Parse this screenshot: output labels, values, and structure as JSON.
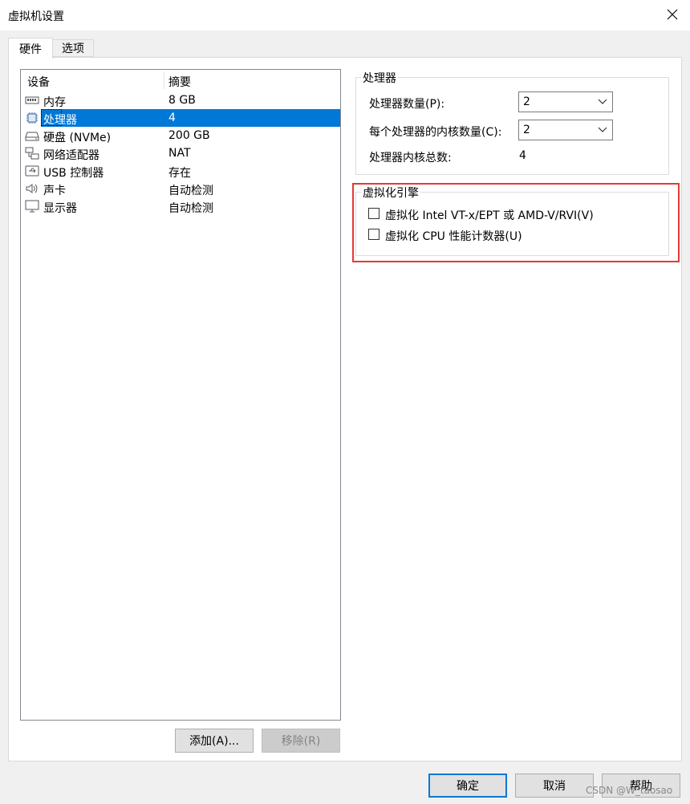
{
  "window": {
    "title": "虚拟机设置"
  },
  "tabs": [
    {
      "label": "硬件",
      "active": true
    },
    {
      "label": "选项",
      "active": false
    }
  ],
  "device_list": {
    "columns": [
      "设备",
      "摘要"
    ],
    "rows": [
      {
        "name": "内存",
        "summary": "8 GB",
        "icon": "memory-icon"
      },
      {
        "name": "处理器",
        "summary": "4",
        "icon": "processor-icon",
        "selected": true
      },
      {
        "name": "硬盘 (NVMe)",
        "summary": "200 GB",
        "icon": "hard-disk-icon"
      },
      {
        "name": "网络适配器",
        "summary": "NAT",
        "icon": "network-adapter-icon"
      },
      {
        "name": "USB 控制器",
        "summary": "存在",
        "icon": "usb-controller-icon"
      },
      {
        "name": "声卡",
        "summary": "自动检测",
        "icon": "sound-card-icon"
      },
      {
        "name": "显示器",
        "summary": "自动检测",
        "icon": "display-icon"
      }
    ]
  },
  "device_buttons": {
    "add": "添加(A)...",
    "remove": "移除(R)"
  },
  "processor_group": {
    "title": "处理器",
    "count_label": "处理器数量(P):",
    "count_value": "2",
    "cores_label": "每个处理器的内核数量(C):",
    "cores_value": "2",
    "total_label": "处理器内核总数:",
    "total_value": "4"
  },
  "virtualization_group": {
    "title": "虚拟化引擎",
    "option1": "虚拟化 Intel VT-x/EPT 或 AMD-V/RVI(V)",
    "option1_checked": false,
    "option2": "虚拟化 CPU 性能计数器(U)",
    "option2_checked": false
  },
  "dialog_buttons": {
    "ok": "确定",
    "cancel": "取消",
    "help": "帮助"
  },
  "watermark": "CSDN @W_taosao",
  "colors": {
    "selection": "#0078d7",
    "highlight_box": "#e53935"
  }
}
